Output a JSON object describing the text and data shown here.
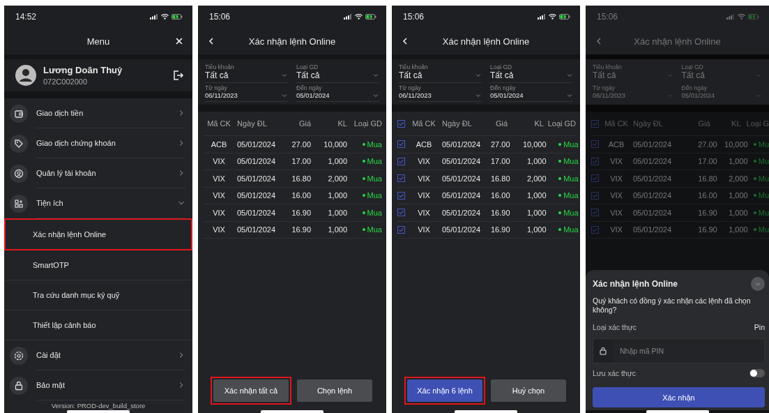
{
  "screens": [
    {
      "kind": "menu",
      "time": "14:52",
      "title": "Menu",
      "profile": {
        "name": "Lương Doãn Thuỷ",
        "account": "072C002000"
      },
      "items": [
        {
          "label": "Giao dịch tiền",
          "expanded": false
        },
        {
          "label": "Giao dịch chứng khoán",
          "expanded": false
        },
        {
          "label": "Quản lý tài khoản",
          "expanded": false
        },
        {
          "label": "Tiện ích",
          "expanded": true,
          "children": [
            {
              "label": "Xác nhận lệnh Online",
              "highlighted": true
            },
            {
              "label": "SmartOTP",
              "highlighted": false
            },
            {
              "label": "Tra cứu danh mục ký quỹ",
              "highlighted": false
            },
            {
              "label": "Thiết lập cảnh báo",
              "highlighted": false
            }
          ]
        },
        {
          "label": "Cài đặt",
          "expanded": false
        },
        {
          "label": "Bảo mật",
          "expanded": false
        }
      ],
      "version": "Version: PROD-dev_build_store"
    },
    {
      "kind": "orders",
      "time": "15:06",
      "title": "Xác nhận lệnh Online",
      "dimmed": false,
      "selectable": false,
      "filters": [
        {
          "label": "Tiểu khoản",
          "value": "Tất cả"
        },
        {
          "label": "Loại GD",
          "value": "Tất cả"
        },
        {
          "label": "Từ ngày",
          "value": "06/11/2023"
        },
        {
          "label": "Đến ngày",
          "value": "05/01/2024"
        }
      ],
      "columns": [
        "Mã CK",
        "Ngày ĐL",
        "Giá",
        "KL",
        "Loại GD"
      ],
      "rows": [
        {
          "code": "ACB",
          "date": "05/01/2024",
          "price": "27.00",
          "qty": "10,000",
          "side": "Mua"
        },
        {
          "code": "VIX",
          "date": "05/01/2024",
          "price": "17.00",
          "qty": "1,000",
          "side": "Mua"
        },
        {
          "code": "VIX",
          "date": "05/01/2024",
          "price": "16.80",
          "qty": "2,000",
          "side": "Mua"
        },
        {
          "code": "VIX",
          "date": "05/01/2024",
          "price": "16.00",
          "qty": "1,000",
          "side": "Mua"
        },
        {
          "code": "VIX",
          "date": "05/01/2024",
          "price": "16.90",
          "qty": "1,000",
          "side": "Mua"
        },
        {
          "code": "VIX",
          "date": "05/01/2024",
          "price": "16.90",
          "qty": "1,000",
          "side": "Mua"
        }
      ],
      "buttons": [
        {
          "label": "Xác nhận tất cả",
          "kind": "secondary",
          "highlighted": true
        },
        {
          "label": "Chọn lệnh",
          "kind": "secondary",
          "highlighted": false
        }
      ]
    },
    {
      "kind": "orders",
      "time": "15:06",
      "title": "Xác nhận lệnh Online",
      "dimmed": false,
      "selectable": true,
      "all_checked": true,
      "filters": [
        {
          "label": "Tiểu khoản",
          "value": "Tất cả"
        },
        {
          "label": "Loại GD",
          "value": "Tất cả"
        },
        {
          "label": "Từ ngày",
          "value": "06/11/2023"
        },
        {
          "label": "Đến ngày",
          "value": "05/01/2024"
        }
      ],
      "columns": [
        "Mã CK",
        "Ngày ĐL",
        "Giá",
        "KL",
        "Loại GD"
      ],
      "rows": [
        {
          "checked": true,
          "code": "ACB",
          "date": "05/01/2024",
          "price": "27.00",
          "qty": "10,000",
          "side": "Mua"
        },
        {
          "checked": true,
          "code": "VIX",
          "date": "05/01/2024",
          "price": "17.00",
          "qty": "1,000",
          "side": "Mua"
        },
        {
          "checked": true,
          "code": "VIX",
          "date": "05/01/2024",
          "price": "16.80",
          "qty": "2,000",
          "side": "Mua"
        },
        {
          "checked": true,
          "code": "VIX",
          "date": "05/01/2024",
          "price": "16.00",
          "qty": "1,000",
          "side": "Mua"
        },
        {
          "checked": true,
          "code": "VIX",
          "date": "05/01/2024",
          "price": "16.90",
          "qty": "1,000",
          "side": "Mua"
        },
        {
          "checked": true,
          "code": "VIX",
          "date": "05/01/2024",
          "price": "16.90",
          "qty": "1,000",
          "side": "Mua"
        }
      ],
      "buttons": [
        {
          "label": "Xác nhận 6 lệnh",
          "kind": "primary",
          "highlighted": true
        },
        {
          "label": "Huỷ chọn",
          "kind": "secondary",
          "highlighted": false
        }
      ]
    },
    {
      "kind": "orders",
      "time": "15:06",
      "title": "Xác nhận lệnh Online",
      "dimmed": true,
      "selectable": true,
      "all_checked": true,
      "filters": [
        {
          "label": "Tiểu khoản",
          "value": "Tất cả"
        },
        {
          "label": "Loại GD",
          "value": "Tất cả"
        },
        {
          "label": "Từ ngày",
          "value": "06/11/2023"
        },
        {
          "label": "Đến ngày",
          "value": "05/01/2024"
        }
      ],
      "columns": [
        "Mã CK",
        "Ngày ĐL",
        "Giá",
        "KL",
        "Loại G"
      ],
      "rows": [
        {
          "checked": true,
          "code": "ACB",
          "date": "05/01/2024",
          "price": "27.00",
          "qty": "10,000",
          "side": "Mu"
        },
        {
          "checked": true,
          "code": "VIX",
          "date": "05/01/2024",
          "price": "17.00",
          "qty": "1,000",
          "side": "Mu"
        },
        {
          "checked": true,
          "code": "VIX",
          "date": "05/01/2024",
          "price": "16.80",
          "qty": "2,000",
          "side": "Mu"
        },
        {
          "checked": true,
          "code": "VIX",
          "date": "05/01/2024",
          "price": "16.00",
          "qty": "1,000",
          "side": "Mu"
        },
        {
          "checked": true,
          "code": "VIX",
          "date": "05/01/2024",
          "price": "16.90",
          "qty": "1,000",
          "side": "Mu"
        },
        {
          "checked": true,
          "code": "VIX",
          "date": "05/01/2024",
          "price": "16.90",
          "qty": "1,000",
          "side": "Mu"
        }
      ],
      "sheet": {
        "title": "Xác nhận lệnh Online",
        "message": "Quý khách có đồng ý xác nhận các lệnh đã chọn không?",
        "auth_label": "Loại xác thực",
        "auth_value": "Pin",
        "pin_placeholder": "Nhập mã PIN",
        "save_label": "Lưu xác thực",
        "save_on": false,
        "confirm": "Xác nhận"
      }
    }
  ]
}
